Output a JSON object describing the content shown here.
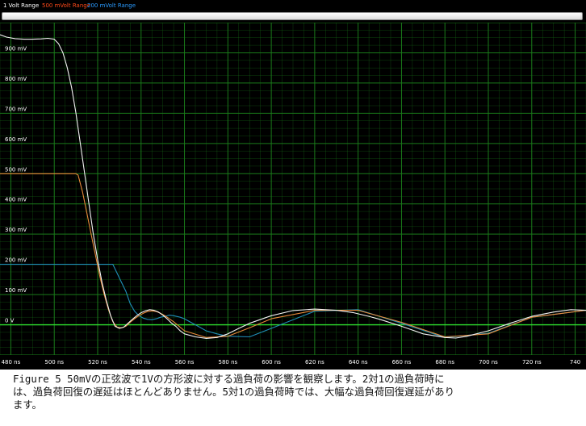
{
  "legend": [
    {
      "label": "1 Volt Range",
      "color": "#ffffff"
    },
    {
      "label": "500 mVolt Range",
      "color": "#ff4a1a"
    },
    {
      "label": "200 mVolt Range",
      "color": "#2a9bff"
    }
  ],
  "caption": {
    "lines": [
      "Figure 5  50mVの正弦波で1Vの方形波に対する過負荷の影響を観察します。2対1の過負荷時に",
      "は、過負荷回復の遅延はほとんどありません。5対1の過負荷時では、大幅な過負荷回復遅延があり",
      "ます。"
    ]
  },
  "colors": {
    "background": "#000000",
    "grid": "#1a7a1a",
    "zero_line": "#2ee02e",
    "trace_1v": "#f2f2f2",
    "trace_500mv": "#e88a3a",
    "trace_200mv": "#1f8fb8"
  },
  "chart_data": {
    "type": "line",
    "title": "",
    "xlabel": "",
    "ylabel": "",
    "x_unit": "ns",
    "y_unit": "mV",
    "xlim": [
      475,
      745
    ],
    "ylim": [
      -100,
      1000
    ],
    "x_tick_labels": [
      "480 ns",
      "500 ns",
      "520 ns",
      "540 ns",
      "560 ns",
      "580 ns",
      "600 ns",
      "620 ns",
      "640 ns",
      "660 ns",
      "680 ns",
      "700 ns",
      "720 ns",
      "740"
    ],
    "y_tick_labels": [
      "900 mV",
      "800 mV",
      "700 mV",
      "600 mV",
      "500 mV",
      "400 mV",
      "300 mV",
      "200 mV",
      "100 mV",
      "0 V"
    ],
    "x_ticks": [
      480,
      500,
      520,
      540,
      560,
      580,
      600,
      620,
      640,
      660,
      680,
      700,
      720,
      740
    ],
    "y_ticks": [
      900,
      800,
      700,
      600,
      500,
      400,
      300,
      200,
      100,
      0
    ],
    "grid": true,
    "series": [
      {
        "name": "1 Volt Range",
        "x": [
          475,
          478,
          482,
          486,
          490,
          494,
          497,
          500,
          502,
          504,
          506,
          508,
          510,
          512,
          514,
          516,
          518,
          520,
          522,
          524,
          526,
          528,
          530,
          532,
          534,
          536,
          538,
          540,
          542,
          544,
          546,
          548,
          550,
          552,
          554,
          556,
          558,
          560,
          565,
          570,
          575,
          580,
          585,
          590,
          600,
          610,
          620,
          630,
          638,
          645,
          650,
          660,
          670,
          680,
          685,
          690,
          700,
          710,
          720,
          730,
          738,
          745
        ],
        "y": [
          960,
          952,
          947,
          945,
          945,
          946,
          948,
          945,
          930,
          900,
          850,
          785,
          700,
          600,
          500,
          400,
          300,
          215,
          140,
          80,
          30,
          -5,
          -12,
          -8,
          5,
          18,
          30,
          40,
          46,
          50,
          48,
          42,
          32,
          20,
          6,
          -5,
          -20,
          -30,
          -40,
          -45,
          -42,
          -30,
          -12,
          5,
          30,
          47,
          52,
          48,
          40,
          28,
          18,
          -5,
          -30,
          -42,
          -44,
          -38,
          -20,
          5,
          28,
          42,
          50,
          48
        ]
      },
      {
        "name": "500 mVolt Range",
        "x": [
          475,
          480,
          490,
          500,
          510,
          511,
          513,
          515,
          517,
          519,
          521,
          523,
          525,
          527,
          529,
          531,
          533,
          535,
          537,
          539,
          541,
          543,
          545,
          547,
          549,
          551,
          553,
          555,
          560,
          570,
          580,
          590,
          600,
          620,
          640,
          660,
          680,
          700,
          720,
          745
        ],
        "y": [
          500,
          500,
          500,
          500,
          500,
          495,
          440,
          370,
          300,
          230,
          160,
          100,
          50,
          10,
          -8,
          -10,
          -5,
          8,
          20,
          30,
          38,
          44,
          46,
          44,
          38,
          30,
          20,
          10,
          -20,
          -42,
          -38,
          -10,
          20,
          48,
          48,
          8,
          -40,
          -30,
          25,
          48
        ]
      },
      {
        "name": "200 mVolt Range",
        "x": [
          475,
          480,
          490,
          500,
          510,
          520,
          525,
          527,
          529,
          531,
          533,
          535,
          537,
          539,
          541,
          543,
          545,
          547,
          549,
          551,
          553,
          555,
          558,
          560,
          562,
          565,
          570,
          575,
          580,
          590,
          600,
          620,
          640,
          660,
          680,
          700,
          720,
          745
        ],
        "y": [
          200,
          200,
          200,
          200,
          200,
          200,
          200,
          200,
          170,
          140,
          110,
          70,
          45,
          30,
          22,
          18,
          17,
          20,
          25,
          28,
          32,
          30,
          25,
          20,
          12,
          0,
          -20,
          -30,
          -38,
          -40,
          -12,
          45,
          50,
          5,
          -42,
          -28,
          25,
          48
        ]
      }
    ]
  }
}
